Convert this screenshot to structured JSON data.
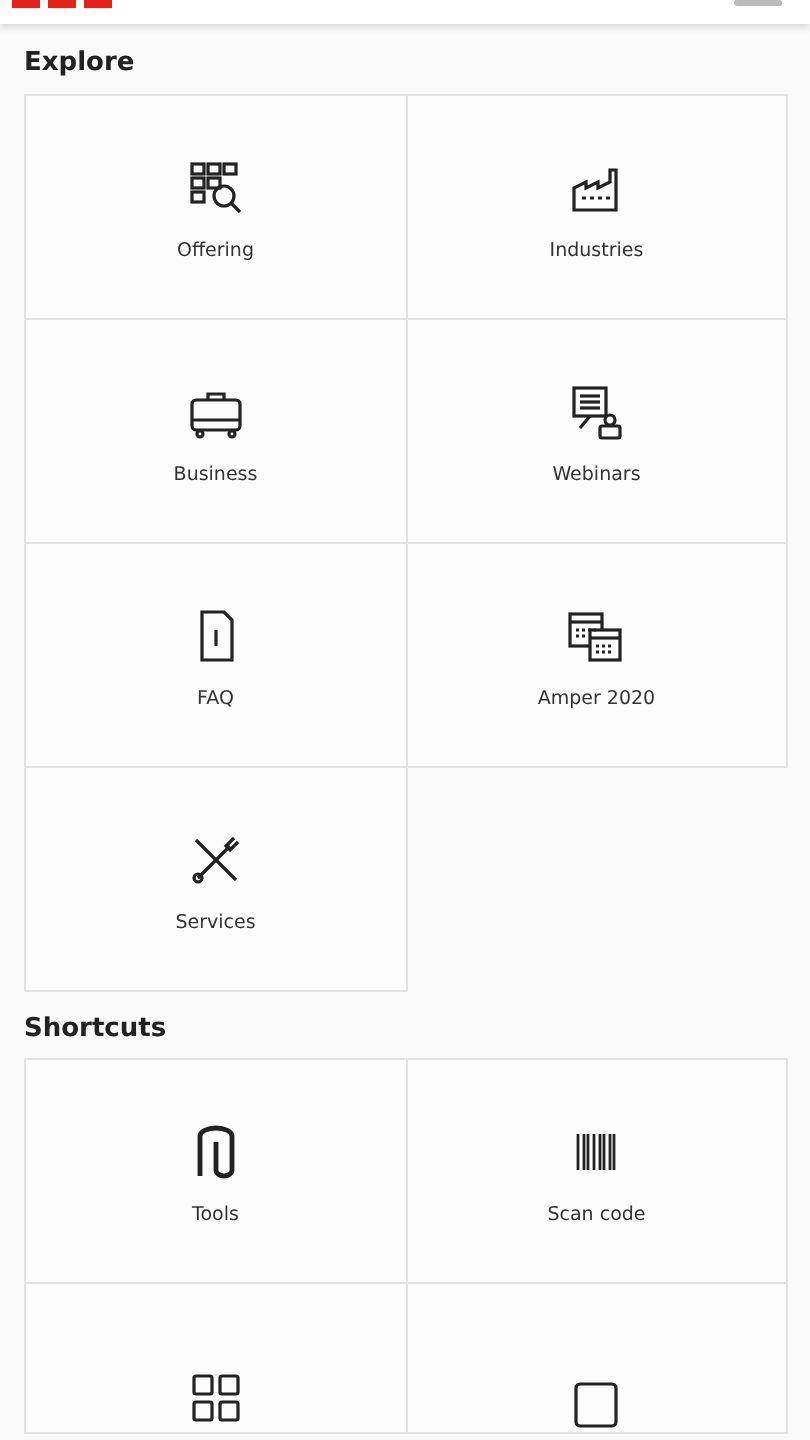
{
  "sections": [
    {
      "title": "Explore",
      "tiles": [
        {
          "kind": "tile",
          "label": "Offering"
        },
        {
          "kind": "tile",
          "label": "Industries"
        },
        {
          "kind": "tile",
          "label": "Business"
        },
        {
          "kind": "tile",
          "label": "Webinars"
        },
        {
          "kind": "tile",
          "label": "FAQ"
        },
        {
          "kind": "tile",
          "label": "Amper 2020"
        },
        {
          "kind": "tile",
          "label": "Services"
        }
      ]
    },
    {
      "title": "Shortcuts",
      "tiles": [
        {
          "kind": "tile",
          "label": "Tools"
        },
        {
          "kind": "tile",
          "label": "Scan code"
        },
        {
          "kind": "cut"
        },
        {
          "kind": "cut"
        }
      ]
    }
  ]
}
